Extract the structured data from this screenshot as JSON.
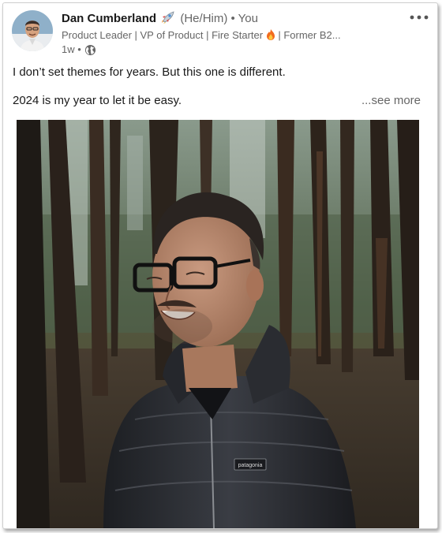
{
  "author": {
    "name": "Dan Cumberland",
    "pronouns": "(He/Him)",
    "connection": "• You",
    "headline": "Product Leader | VP of Product | Fire Starter",
    "headline_tail": " | Former B2...",
    "time": "1w •"
  },
  "post": {
    "line1": "I don’t set themes for years. But this one is different.",
    "line2": "2024 is my year to let it be easy.",
    "see_more": "...see more"
  },
  "jacket_logo": "patagonia",
  "icons": {
    "more": "more-horizontal-icon",
    "rocket": "rocket-emoji-icon",
    "flame": "fire-emoji-icon",
    "visibility": "globe-icon"
  },
  "colors": {
    "text_primary": "#191919",
    "text_secondary": "#666666"
  }
}
